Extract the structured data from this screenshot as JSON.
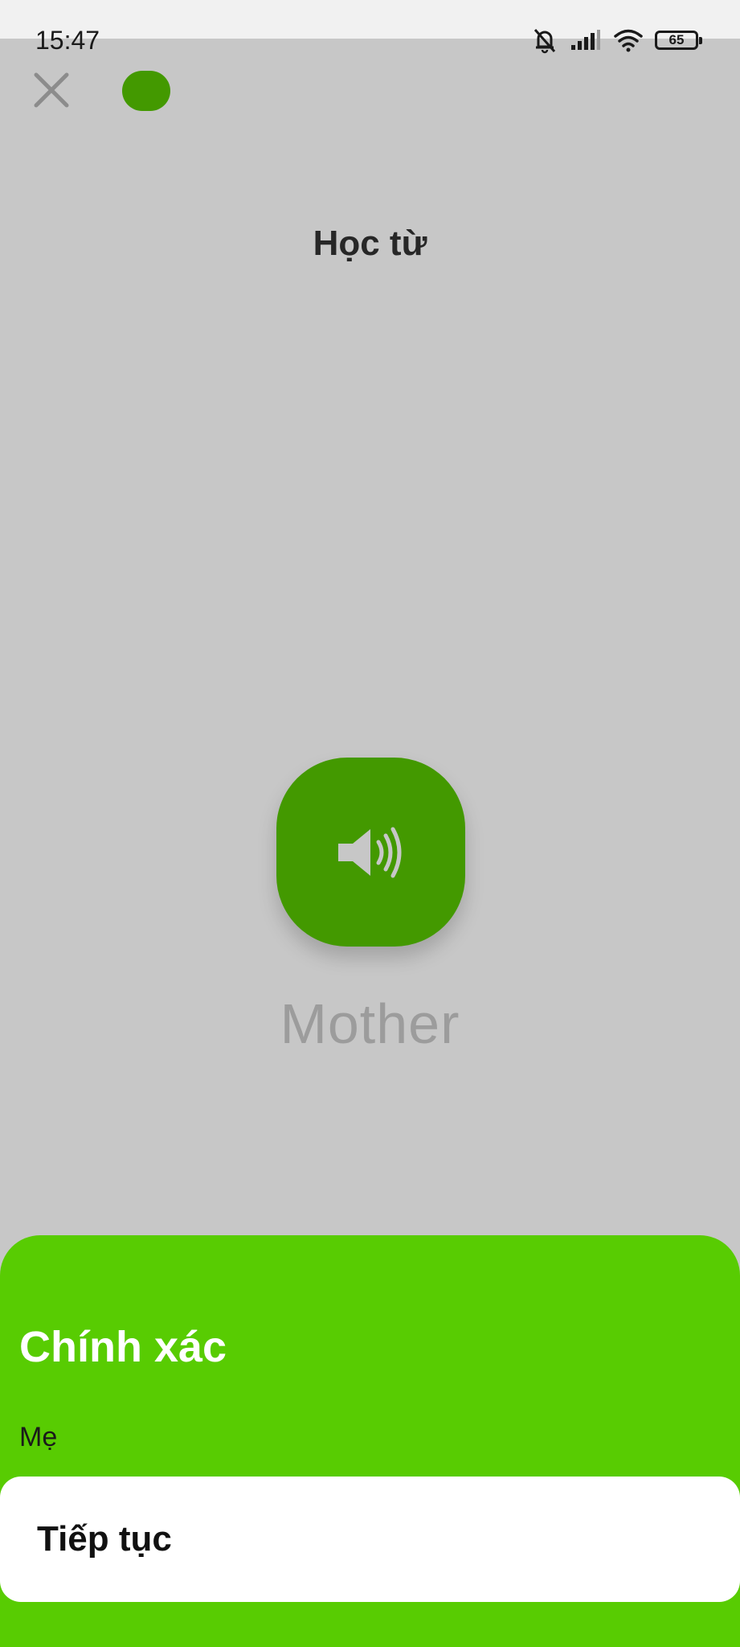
{
  "status_bar": {
    "time": "15:47",
    "battery_level": "65",
    "icons": [
      "bell-muted-icon",
      "signal-icon",
      "wifi-icon",
      "battery-icon"
    ]
  },
  "lesson": {
    "title": "Học từ",
    "word": "Mother",
    "progress_pill_color": "#56c400",
    "audio_button_color": "#56c400"
  },
  "feedback": {
    "status": "Chính xác",
    "meaning": "Mẹ",
    "continue_label": "Tiếp tục",
    "sheet_color": "#58cc02"
  }
}
